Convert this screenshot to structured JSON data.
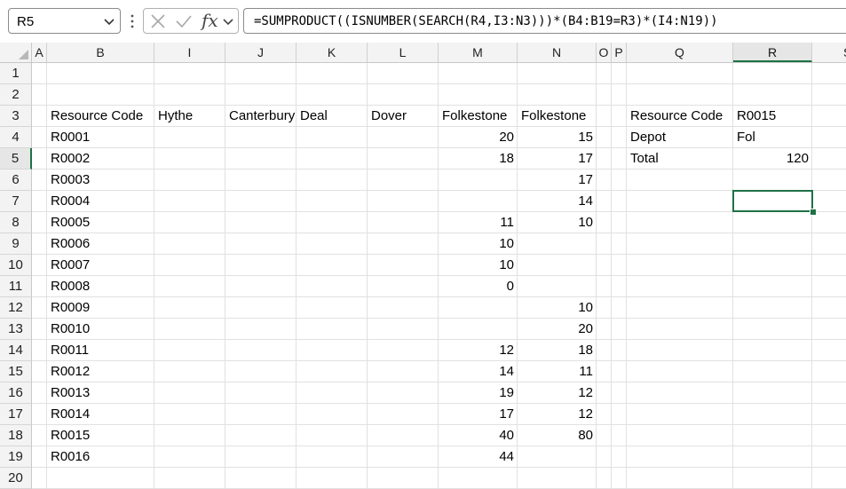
{
  "name_box": {
    "value": "R5"
  },
  "formula_bar": {
    "formula": "=SUMPRODUCT((ISNUMBER(SEARCH(R4,I3:N3)))*(B4:B19=R3)*(I4:N19))",
    "fx_label": "fx"
  },
  "columns": [
    "A",
    "B",
    "I",
    "J",
    "K",
    "L",
    "M",
    "N",
    "O",
    "P",
    "Q",
    "R",
    "S"
  ],
  "selected_column": "R",
  "rows": [
    "1",
    "2",
    "3",
    "4",
    "5",
    "6",
    "7",
    "8",
    "9",
    "10",
    "11",
    "12",
    "13",
    "14",
    "15",
    "16",
    "17",
    "18",
    "19",
    "20"
  ],
  "selected_row": "5",
  "cells": {
    "B3": "Resource Code",
    "I3": "Hythe",
    "J3": "Canterbury",
    "K3": "Deal",
    "L3": "Dover",
    "M3": "Folkestone",
    "N3": "Folkestone",
    "B4": "R0001",
    "M4": "20",
    "N4": "15",
    "B5": "R0002",
    "M5": "18",
    "N5": "17",
    "B6": "R0003",
    "N6": "17",
    "B7": "R0004",
    "N7": "14",
    "B8": "R0005",
    "M8": "11",
    "N8": "10",
    "B9": "R0006",
    "M9": "10",
    "B10": "R0007",
    "M10": "10",
    "B11": "R0008",
    "M11": "0",
    "B12": "R0009",
    "N12": "10",
    "B13": "R0010",
    "N13": "20",
    "B14": "R0011",
    "M14": "12",
    "N14": "18",
    "B15": "R0012",
    "M15": "14",
    "N15": "11",
    "B16": "R0013",
    "M16": "19",
    "N16": "12",
    "B17": "R0014",
    "M17": "17",
    "N17": "12",
    "B18": "R0015",
    "M18": "40",
    "N18": "80",
    "B19": "R0016",
    "M19": "44",
    "Q3": "Resource Code",
    "R3": "R0015",
    "Q4": "Depot",
    "R4": "Fol",
    "Q5": "Total",
    "R5": "120"
  },
  "accent_color": "#1e7145"
}
